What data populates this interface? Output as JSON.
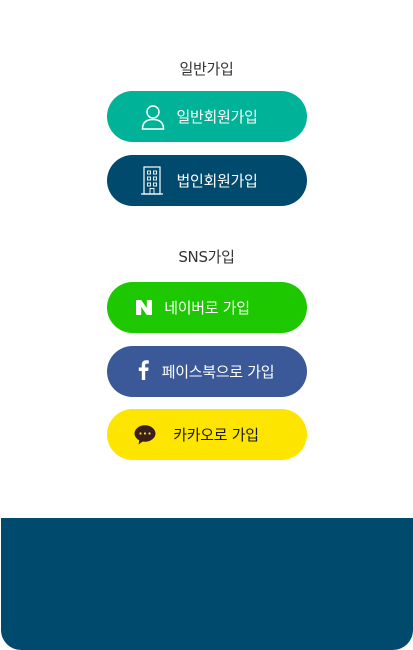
{
  "general": {
    "section_title": "일반가입",
    "individual_button": {
      "label": "일반회원가입",
      "icon": "user-icon",
      "color": "#00b398"
    },
    "corporate_button": {
      "label": "법인회원가입",
      "icon": "building-icon",
      "color": "#004a6e"
    }
  },
  "sns": {
    "section_title": "SNS가입",
    "naver_button": {
      "label": "네이버로 가입",
      "icon": "naver-icon",
      "color": "#1ec800"
    },
    "facebook_button": {
      "label": "페이스북으로 가입",
      "icon": "facebook-icon",
      "color": "#3b5998"
    },
    "kakao_button": {
      "label": "카카오로 가입",
      "icon": "kakao-icon",
      "color": "#fee500"
    }
  },
  "footer": {
    "color": "#004a6e"
  }
}
